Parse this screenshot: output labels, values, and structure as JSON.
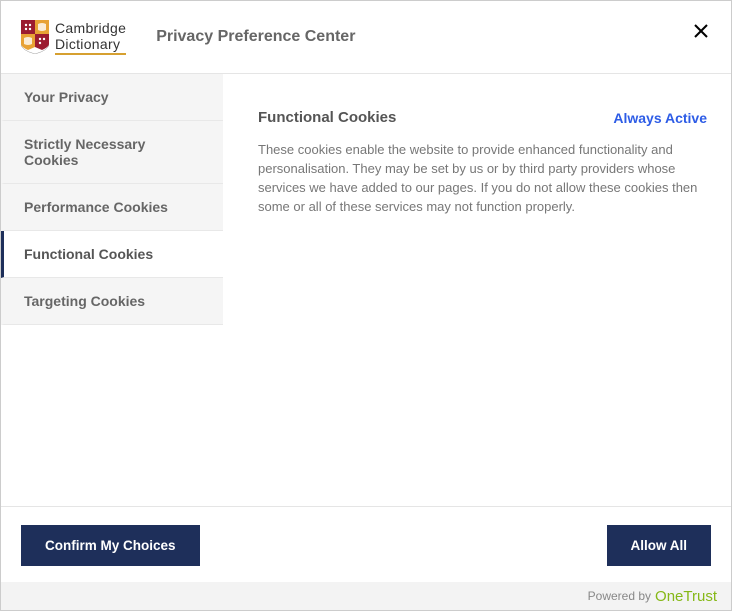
{
  "header": {
    "logo_line1": "Cambridge",
    "logo_line2": "Dictionary",
    "title": "Privacy Preference Center"
  },
  "sidebar": {
    "items": [
      {
        "label": "Your Privacy"
      },
      {
        "label": "Strictly Necessary Cookies"
      },
      {
        "label": "Performance Cookies"
      },
      {
        "label": "Functional Cookies"
      },
      {
        "label": "Targeting Cookies"
      }
    ]
  },
  "content": {
    "title": "Functional Cookies",
    "status": "Always Active",
    "description": "These cookies enable the website to provide enhanced functionality and personalisation. They may be set by us or by third party providers whose services we have added to our pages. If you do not allow these cookies then some or all of these services may not function properly."
  },
  "footer": {
    "confirm_label": "Confirm My Choices",
    "allow_label": "Allow All",
    "powered_label": "Powered by",
    "onetrust_label": "OneTrust"
  }
}
